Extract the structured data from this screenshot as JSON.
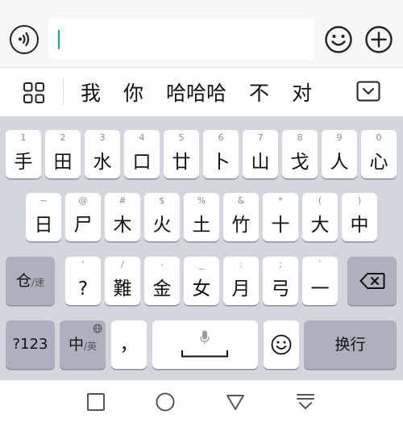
{
  "input_bar": {
    "voice_icon": "voice-waves-icon",
    "emoji_icon": "smiley-icon",
    "plus_icon": "plus-circle-icon",
    "caret_color": "#07c160"
  },
  "candidate_bar": {
    "grid_icon": "grid-four-squares-icon",
    "candidates": [
      "我",
      "你",
      "哈哈哈",
      "不",
      "对"
    ],
    "collapse_icon": "collapse-keyboard-icon"
  },
  "keyboard": {
    "row1": [
      {
        "sub": "1",
        "main": "手"
      },
      {
        "sub": "2",
        "main": "田"
      },
      {
        "sub": "3",
        "main": "水"
      },
      {
        "sub": "4",
        "main": "口"
      },
      {
        "sub": "5",
        "main": "廿"
      },
      {
        "sub": "6",
        "main": "卜"
      },
      {
        "sub": "7",
        "main": "山"
      },
      {
        "sub": "8",
        "main": "戈"
      },
      {
        "sub": "9",
        "main": "人"
      },
      {
        "sub": "0",
        "main": "心"
      }
    ],
    "row2": [
      {
        "sub": "~",
        "main": "日"
      },
      {
        "sub": "@",
        "main": "尸"
      },
      {
        "sub": "#",
        "main": "木"
      },
      {
        "sub": "$",
        "main": "火"
      },
      {
        "sub": "%",
        "main": "土"
      },
      {
        "sub": "&",
        "main": "竹"
      },
      {
        "sub": "*",
        "main": "十"
      },
      {
        "sub": "(",
        "main": "大"
      },
      {
        "sub": ")",
        "main": "中"
      }
    ],
    "row3": [
      {
        "sub": "'",
        "main": "?"
      },
      {
        "sub": "/",
        "main": "難"
      },
      {
        "sub": "-",
        "main": "金"
      },
      {
        "sub": "_",
        "main": "女"
      },
      {
        "sub": ":",
        "main": "月"
      },
      {
        "sub": ";",
        "main": "弓"
      },
      {
        "sub": "`",
        "main": "一"
      }
    ],
    "shift_key": {
      "main": "仓",
      "sub": "/速"
    },
    "backspace_icon": "backspace-icon",
    "num_key": "?123",
    "lang_key": {
      "main": "中",
      "sub": "/英"
    },
    "globe_icon": "globe-icon",
    "comma_key": "，",
    "mic_icon": "microphone-icon",
    "space_icon": "space-bar-icon",
    "smiley_icon": "smiley-key-icon",
    "enter_key": "换行"
  },
  "nav_bar": {
    "recents_icon": "square-recents-icon",
    "home_icon": "circle-home-icon",
    "back_icon": "triangle-back-icon",
    "hide_keyboard_icon": "hide-keyboard-icon"
  }
}
